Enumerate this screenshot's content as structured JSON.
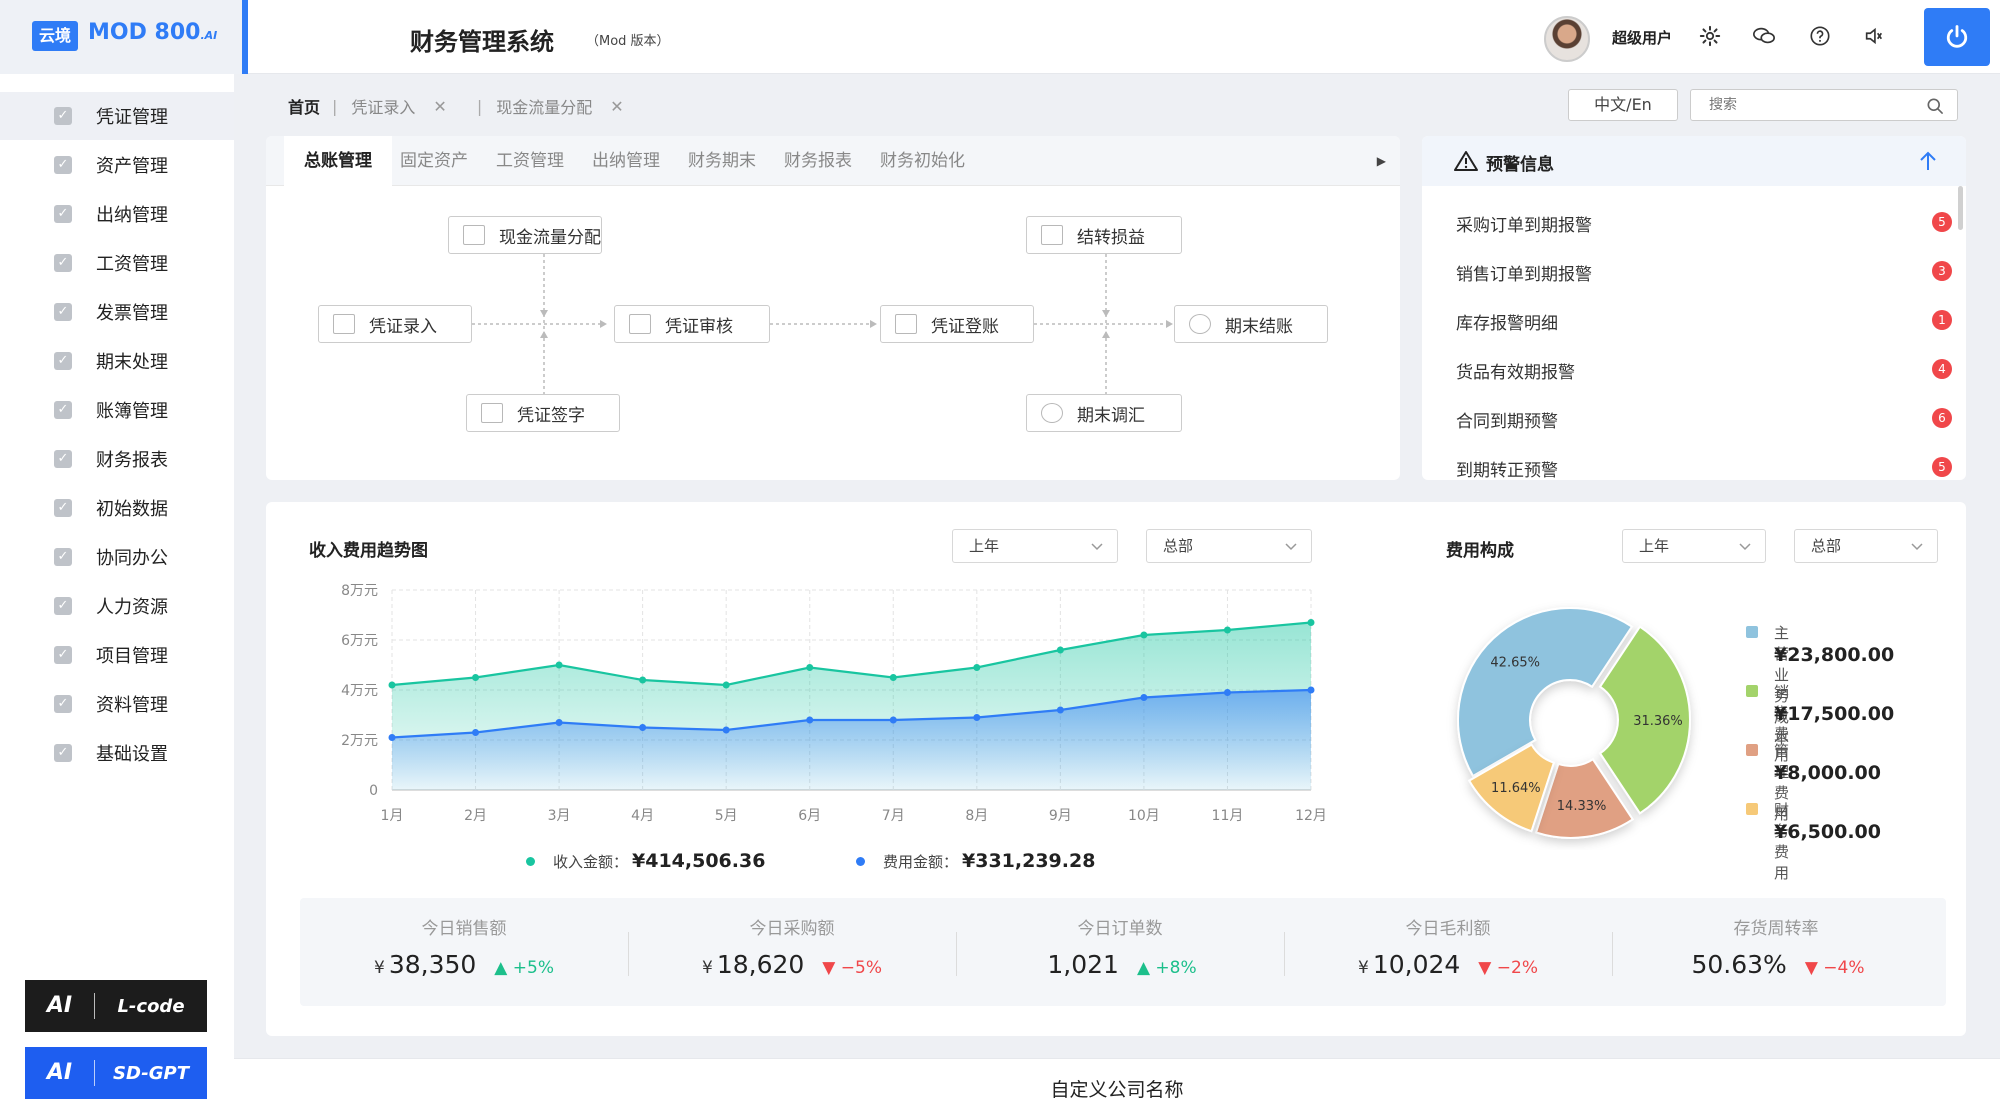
{
  "header": {
    "logo_badge": "云境",
    "logo_text": "MOD 800",
    "logo_sup": ".AI",
    "title": "财务管理系统",
    "subtitle": "（Mod 版本）",
    "username": "超级用户"
  },
  "sidebar": {
    "items": [
      {
        "label": "凭证管理"
      },
      {
        "label": "资产管理"
      },
      {
        "label": "出纳管理"
      },
      {
        "label": "工资管理"
      },
      {
        "label": "发票管理"
      },
      {
        "label": "期末处理"
      },
      {
        "label": "账簿管理"
      },
      {
        "label": "财务报表"
      },
      {
        "label": "初始数据"
      },
      {
        "label": "协同办公"
      },
      {
        "label": "人力资源"
      },
      {
        "label": "项目管理"
      },
      {
        "label": "资料管理"
      },
      {
        "label": "基础设置"
      }
    ],
    "ai_buttons": [
      {
        "ai": "AI",
        "name": "L-code",
        "color": "#1c1c1c"
      },
      {
        "ai": "AI",
        "name": "SD-GPT",
        "color": "#1e5ef0"
      }
    ]
  },
  "breadcrumb": {
    "home": "首页",
    "tabs": [
      "凭证录入",
      "现金流量分配"
    ]
  },
  "toolbar": {
    "lang": "中文/En",
    "search_placeholder": "搜索"
  },
  "module_tabs": [
    "总账管理",
    "固定资产",
    "工资管理",
    "出纳管理",
    "财务期末",
    "财务报表",
    "财务初始化"
  ],
  "flow": {
    "nodes": [
      "现金流量分配",
      "凭证录入",
      "凭证审核",
      "凭证签字",
      "结转损益",
      "凭证登账",
      "期末结账",
      "期末调汇"
    ]
  },
  "warnings": {
    "title": "预警信息",
    "items": [
      {
        "label": "采购订单到期报警",
        "count": "5"
      },
      {
        "label": "销售订单到期报警",
        "count": "3"
      },
      {
        "label": "库存报警明细",
        "count": "1"
      },
      {
        "label": "货品有效期报警",
        "count": "4"
      },
      {
        "label": "合同到期预警",
        "count": "6"
      },
      {
        "label": "到期转正预警",
        "count": "5"
      }
    ]
  },
  "trend": {
    "title": "收入费用趋势图",
    "select_period": "上年",
    "select_scope": "总部",
    "legend": [
      {
        "name": "收入金额：",
        "value": "¥414,506.36",
        "color": "#19c5a0"
      },
      {
        "name": "费用金额：",
        "value": "¥331,239.28",
        "color": "#2f7cf6"
      }
    ]
  },
  "chart_data": [
    {
      "type": "area",
      "title": "收入费用趋势图",
      "categories": [
        "1月",
        "2月",
        "3月",
        "4月",
        "5月",
        "6月",
        "7月",
        "8月",
        "9月",
        "10月",
        "11月",
        "12月"
      ],
      "y_ticks": [
        "0",
        "2万元",
        "4万元",
        "6万元",
        "8万元"
      ],
      "ylim": [
        0,
        8
      ],
      "grid": true,
      "series": [
        {
          "name": "收入金额",
          "color": "#19c5a0",
          "values": [
            4.2,
            4.5,
            5.0,
            4.4,
            4.2,
            4.9,
            4.5,
            4.9,
            5.6,
            6.2,
            6.4,
            6.7
          ]
        },
        {
          "name": "费用金额",
          "color": "#2f7cf6",
          "values": [
            2.1,
            2.3,
            2.7,
            2.5,
            2.4,
            2.8,
            2.8,
            2.9,
            3.2,
            3.7,
            3.9,
            4.0
          ]
        }
      ]
    },
    {
      "type": "pie",
      "title": "费用构成",
      "series": [
        {
          "name": "主营业务成本",
          "value": 23800,
          "percent": "42.65%",
          "color": "#8fc3de"
        },
        {
          "name": "销售费用",
          "value": 17500,
          "percent": "31.36%",
          "color": "#a3d36b"
        },
        {
          "name": "管理费用",
          "value": 8000,
          "percent": "14.33%",
          "color": "#e0a083"
        },
        {
          "name": "财务费用",
          "value": 6500,
          "percent": "11.64%",
          "color": "#f6c978"
        }
      ]
    }
  ],
  "pie": {
    "title": "费用构成",
    "select_period": "上年",
    "select_scope": "总部",
    "legend": [
      {
        "name": "主营业务成本",
        "value": "¥23,800.00"
      },
      {
        "name": "销售费用",
        "value": "¥17,500.00"
      },
      {
        "name": "管理费用",
        "value": "¥8,000.00"
      },
      {
        "name": "财务费用",
        "value": "¥6,500.00"
      }
    ]
  },
  "kpis": [
    {
      "label": "今日销售额",
      "cur": "¥",
      "value": "38,350",
      "trend": "+5%",
      "dir": "up"
    },
    {
      "label": "今日采购额",
      "cur": "¥",
      "value": "18,620",
      "trend": "−5%",
      "dir": "down"
    },
    {
      "label": "今日订单数",
      "cur": "",
      "value": "1,021",
      "trend": "+8%",
      "dir": "up"
    },
    {
      "label": "今日毛利额",
      "cur": "¥",
      "value": "10,024",
      "trend": "−2%",
      "dir": "down"
    },
    {
      "label": "存货周转率",
      "cur": "",
      "value": "50.63%",
      "trend": "−4%",
      "dir": "down"
    }
  ],
  "footer": {
    "text": "自定义公司名称"
  }
}
